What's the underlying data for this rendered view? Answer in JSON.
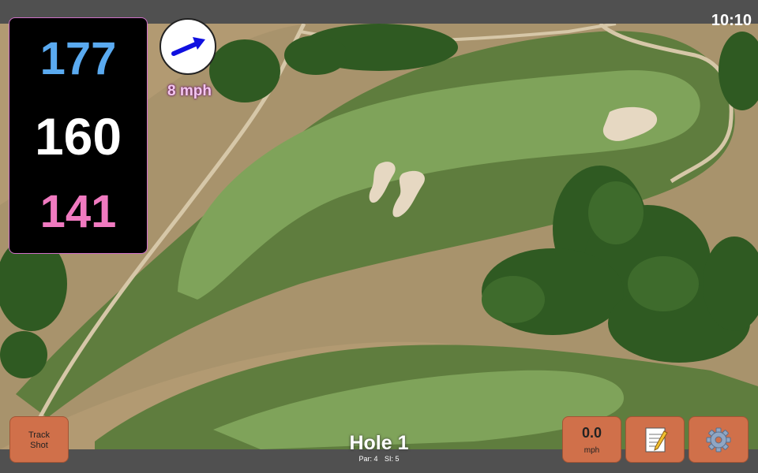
{
  "status_bar": {
    "time": "10:10"
  },
  "distances": {
    "back": "177",
    "middle": "160",
    "front": "141"
  },
  "wind": {
    "speed": "8 mph",
    "icon": "wind-direction-arrow-icon",
    "arrow_color": "#1010e0"
  },
  "track_shot": {
    "label_line1": "Track",
    "label_line2": "Shot"
  },
  "speed_button": {
    "value": "0.0",
    "unit": "mph"
  },
  "notes_button": {
    "icon": "notepad-icon"
  },
  "settings_button": {
    "icon": "gear-icon"
  },
  "hole": {
    "title": "Hole 1",
    "par": "Par: 4",
    "si": "SI: 5"
  },
  "colors": {
    "button": "#d0704a",
    "back_distance": "#5aaaf0",
    "middle_distance": "#ffffff",
    "front_distance": "#f07ac0",
    "panel_border": "#d070c8",
    "fairway": "#7fa35a",
    "rough": "#b59e78",
    "trees": "#2f5a22"
  }
}
